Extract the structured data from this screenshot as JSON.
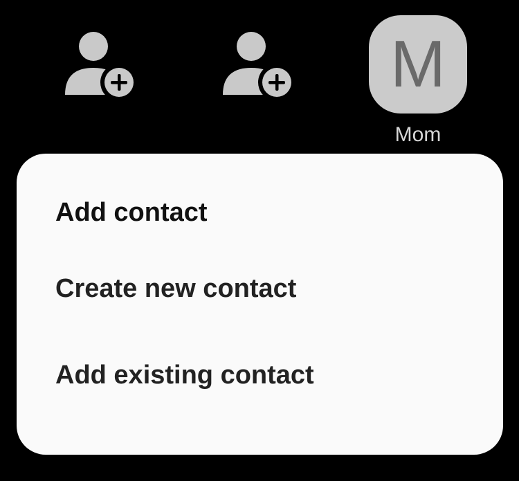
{
  "contacts_row": {
    "slots": [
      {
        "type": "add",
        "icon": "add-person-icon"
      },
      {
        "type": "add",
        "icon": "add-person-icon"
      },
      {
        "type": "contact",
        "initial": "M",
        "name": "Mom"
      }
    ]
  },
  "sheet": {
    "title": "Add contact",
    "items": [
      {
        "label": "Create new contact"
      },
      {
        "label": "Add existing contact"
      }
    ]
  },
  "colors": {
    "background": "#000000",
    "icon_gray": "#c9c9c9",
    "avatar_bg": "#cbcbcb",
    "avatar_text": "#6a6a6a",
    "sheet_bg": "#fafafa",
    "text_dark": "#111111"
  }
}
